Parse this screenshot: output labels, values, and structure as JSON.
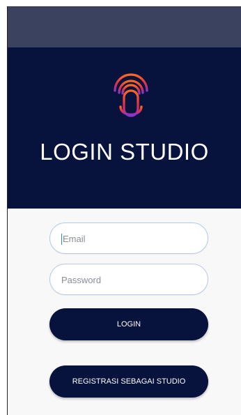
{
  "header": {
    "title": "LOGIN STUDIO"
  },
  "icons": {
    "logo": "microphone-logo-icon"
  },
  "form": {
    "email_placeholder": "Email",
    "password_placeholder": "Password",
    "login_label": "LOGIN",
    "register_label": "REGISTRASI SEBAGAI STUDIO"
  },
  "colors": {
    "header_background": "#07123d",
    "status_bar": "#3a4260",
    "button_background": "#07123d",
    "field_border": "#b9cae8",
    "logo_orange": "#ff6a1f",
    "logo_red": "#e0304c",
    "logo_purple": "#8a35c8"
  }
}
